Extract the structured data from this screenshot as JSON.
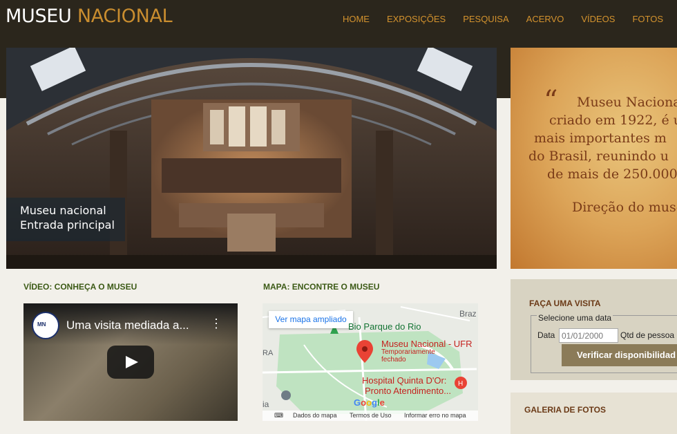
{
  "header": {
    "logo_part1": "MUSEU",
    "logo_part2": "NACIONAL",
    "nav": [
      "HOME",
      "EXPOSIÇÕES",
      "PESQUISA",
      "ACERVO",
      "VÍDEOS",
      "FOTOS"
    ]
  },
  "hero": {
    "caption_line1": "Museu nacional",
    "caption_line2": "Entrada principal"
  },
  "quote": {
    "mark": "“",
    "lines": [
      "Museu Naciona",
      "criado em 1922, é u",
      "mais importantes m",
      "do Brasil, reunindo u",
      "de mais de 250.000"
    ],
    "signature": "Direção do muse"
  },
  "video_section": {
    "title": "VÍDEO: CONHEÇA O MUSEU",
    "video_title": "Uma visita mediada a...",
    "channel_abbr": "MN"
  },
  "map_section": {
    "title": "MAPA: ENCONTRE O MUSEU",
    "expand_label": "Ver mapa ampliado",
    "labels": {
      "park": "Bio Parque do Rio",
      "museum": "Museu Nacional - UFR",
      "museum_status": "Temporariamente fechado",
      "hospital": "Hospital Quinta D'Or:",
      "hospital_2": "Pronto Atendimento...",
      "braz": "Braz",
      "ra": "RA",
      "ia": "ia"
    },
    "footer": [
      "Dados do mapa",
      "Termos de Uso",
      "Informar erro no mapa"
    ]
  },
  "visit": {
    "title": "FAÇA UMA VISITA",
    "legend": "Selecione uma data",
    "date_label": "Data",
    "date_placeholder": "01/01/2000",
    "qty_label": "Qtd de pessoa",
    "button": "Verificar disponibilidad"
  },
  "gallery": {
    "title": "GALERIA DE FOTOS"
  },
  "colors": {
    "topbar": "#2b261c",
    "nav": "#d4932e",
    "logo_accent": "#c98d2f",
    "section_title": "#3c5a16",
    "visit_title": "#6b3a17",
    "button": "#8b7b58"
  }
}
